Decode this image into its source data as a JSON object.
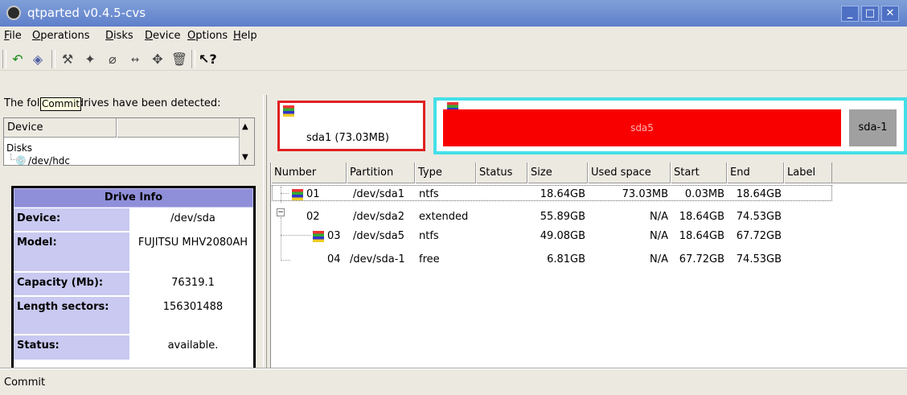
{
  "window": {
    "title": "qtparted v0.4.5-cvs",
    "minimize": "_",
    "maximize": "□",
    "close": "✕"
  },
  "menubar": [
    "File",
    "Operations",
    "Disks",
    "Device",
    "Options",
    "Help"
  ],
  "toolbar": {
    "tooltip": "Commit",
    "buttons": [
      "undo-icon",
      "commit-icon",
      "tool-icon",
      "format-icon",
      "eraser-icon",
      "resize-icon",
      "move-icon",
      "trash-icon",
      "whatsthis-icon"
    ]
  },
  "left_panel": {
    "detected_text": "The following drives have been detected:",
    "tree_header": "Device",
    "tree_root": "Disks",
    "tree_item": "/dev/hdc"
  },
  "drive_info": {
    "title": "Drive Info",
    "rows": [
      {
        "key": "Device:",
        "value": "/dev/sda"
      },
      {
        "key": "Model:",
        "value": "FUJITSU MHV2080AH"
      },
      {
        "key": "Capacity (Mb):",
        "value": "76319.1"
      },
      {
        "key": "Length sectors:",
        "value": "156301488"
      },
      {
        "key": "Status:",
        "value": "available."
      }
    ]
  },
  "disk_map": {
    "sda1_label": "sda1 (73.03MB)",
    "sda5_label": "sda5",
    "free_label": "sda-1",
    "colors": {
      "primary_border": "#e02020",
      "extended_border": "#44e0e8",
      "used_fill": "#f80000",
      "free_fill": "#a0a0a0"
    }
  },
  "partition_table": {
    "columns": [
      "Number",
      "Partition",
      "Type",
      "Status",
      "Size",
      "Used space",
      "Start",
      "End",
      "Label"
    ],
    "rows": [
      {
        "number": "01",
        "partition": "/dev/sda1",
        "type": "ntfs",
        "status": "",
        "size": "18.64GB",
        "used": "73.03MB",
        "start": "0.03MB",
        "end": "18.64GB",
        "label": ""
      },
      {
        "number": "02",
        "partition": "/dev/sda2",
        "type": "extended",
        "status": "",
        "size": "55.89GB",
        "used": "N/A",
        "start": "18.64GB",
        "end": "74.53GB",
        "label": ""
      },
      {
        "number": "03",
        "partition": "/dev/sda5",
        "type": "ntfs",
        "status": "",
        "size": "49.08GB",
        "used": "N/A",
        "start": "18.64GB",
        "end": "67.72GB",
        "label": ""
      },
      {
        "number": "04",
        "partition": "/dev/sda-1",
        "type": "free",
        "status": "",
        "size": "6.81GB",
        "used": "N/A",
        "start": "67.72GB",
        "end": "74.53GB",
        "label": ""
      }
    ]
  },
  "statusbar": {
    "text": "Commit"
  }
}
